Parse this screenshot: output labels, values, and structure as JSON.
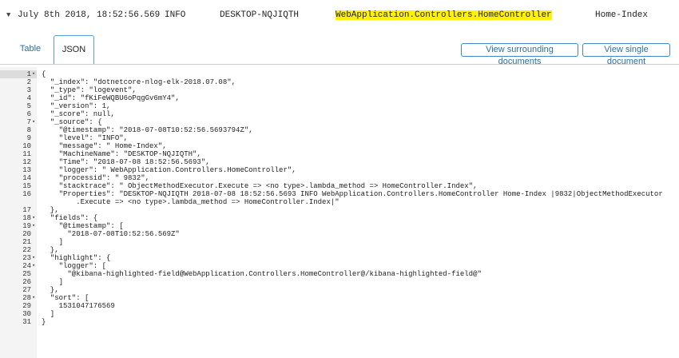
{
  "header": {
    "caret_icon": "caret-down-icon",
    "timestamp": "July 8th 2018, 18:52:56.569",
    "level": "INFO",
    "machine": "DESKTOP-NQJIQTH",
    "logger": "WebApplication.Controllers.HomeController",
    "message": "Home-Index",
    "highlight_color": "#fff200"
  },
  "tabs": [
    {
      "label": "Table"
    },
    {
      "label": "JSON"
    }
  ],
  "buttons": {
    "surrounding": "View surrounding documents",
    "single": "View single document"
  },
  "editor": {
    "lines": [
      {
        "n": "1",
        "fold": true,
        "text": "{"
      },
      {
        "n": "2",
        "fold": false,
        "text": "  \"_index\": \"dotnetcore-nlog-elk-2018.07.08\","
      },
      {
        "n": "3",
        "fold": false,
        "text": "  \"_type\": \"logevent\","
      },
      {
        "n": "4",
        "fold": false,
        "text": "  \"_id\": \"fKiFeWQBU6oPqgGv6mY4\","
      },
      {
        "n": "5",
        "fold": false,
        "text": "  \"_version\": 1,"
      },
      {
        "n": "6",
        "fold": false,
        "text": "  \"_score\": null,"
      },
      {
        "n": "7",
        "fold": true,
        "text": "  \"_source\": {"
      },
      {
        "n": "8",
        "fold": false,
        "text": "    \"@timestamp\": \"2018-07-08T10:52:56.5693794Z\","
      },
      {
        "n": "9",
        "fold": false,
        "text": "    \"level\": \"INFO\","
      },
      {
        "n": "10",
        "fold": false,
        "text": "    \"message\": \" Home-Index\","
      },
      {
        "n": "11",
        "fold": false,
        "text": "    \"MachineName\": \"DESKTOP-NQJIQTH\","
      },
      {
        "n": "12",
        "fold": false,
        "text": "    \"Time\": \"2018-07-08 18:52:56.5693\","
      },
      {
        "n": "13",
        "fold": false,
        "text": "    \"logger\": \" WebApplication.Controllers.HomeController\","
      },
      {
        "n": "14",
        "fold": false,
        "text": "    \"processid\": \" 9832\","
      },
      {
        "n": "15",
        "fold": false,
        "text": "    \"stacktrace\": \" ObjectMethodExecutor.Execute => <no type>.lambda_method => HomeController.Index\","
      },
      {
        "n": "16",
        "fold": false,
        "text": "    \"Properties\": \"DESKTOP-NQJIQTH 2018-07-08 18:52:56.5693 INFO WebApplication.Controllers.HomeController Home-Index |9832|ObjectMethodExecutor"
      },
      {
        "n": "",
        "fold": false,
        "text": "        .Execute => <no type>.lambda_method => HomeController.Index|\""
      },
      {
        "n": "17",
        "fold": false,
        "text": "  },"
      },
      {
        "n": "18",
        "fold": true,
        "text": "  \"fields\": {"
      },
      {
        "n": "19",
        "fold": true,
        "text": "    \"@timestamp\": ["
      },
      {
        "n": "20",
        "fold": false,
        "text": "      \"2018-07-08T10:52:56.569Z\""
      },
      {
        "n": "21",
        "fold": false,
        "text": "    ]"
      },
      {
        "n": "22",
        "fold": false,
        "text": "  },"
      },
      {
        "n": "23",
        "fold": true,
        "text": "  \"highlight\": {"
      },
      {
        "n": "24",
        "fold": true,
        "text": "    \"logger\": ["
      },
      {
        "n": "25",
        "fold": false,
        "text": "      \"@kibana-highlighted-field@WebApplication.Controllers.HomeController@/kibana-highlighted-field@\""
      },
      {
        "n": "26",
        "fold": false,
        "text": "    ]"
      },
      {
        "n": "27",
        "fold": false,
        "text": "  },"
      },
      {
        "n": "28",
        "fold": true,
        "text": "  \"sort\": ["
      },
      {
        "n": "29",
        "fold": false,
        "text": "    1531047176569"
      },
      {
        "n": "30",
        "fold": false,
        "text": "  ]"
      },
      {
        "n": "31",
        "fold": false,
        "text": "}"
      }
    ]
  }
}
